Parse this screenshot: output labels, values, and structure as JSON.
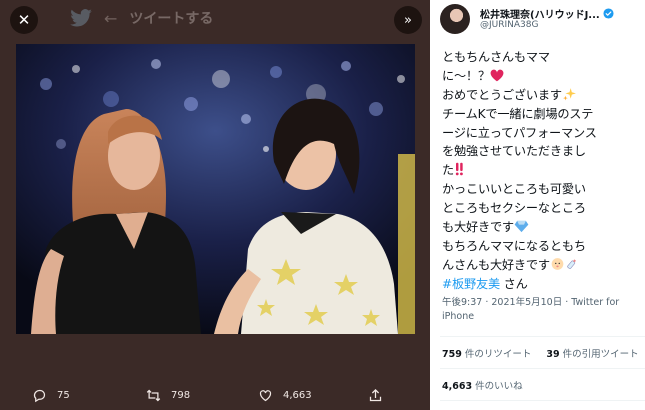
{
  "header": {
    "title": "ツイートする"
  },
  "viewer": {
    "actions": {
      "reply_count": "75",
      "retweet_count": "798",
      "like_count": "4,663"
    }
  },
  "tweet": {
    "display_name": "松井珠理奈(ハリウッドJ...",
    "handle": "@JURINA38G",
    "text_lines": [
      "ともちんさんもママ",
      "に〜！？",
      "おめでとうございます",
      "チームKで一緒に劇場のステ",
      "ージに立ってパフォーマンス",
      "を勉強させていただきまし",
      "た",
      "かっこいいところも可愛い",
      "ところもセクシーなところ",
      "も大好きです",
      "もちろんママになるともち",
      "んさんも大好きです",
      "#板野友美",
      " さん"
    ],
    "timestamp_line1": "午後9:37 · 2021年5月10日 · Twitter for",
    "timestamp_line2": "iPhone",
    "retweets": {
      "count": "759",
      "label": " 件のリツイート"
    },
    "quotes": {
      "count": "39",
      "label": " 件の引用ツイート"
    },
    "likes": {
      "count": "4,663",
      "label": " 件のいいね"
    }
  },
  "colors": {
    "viewer_bg": "#3b2a27",
    "link": "#1d9bf0",
    "verified": "#1d9bf0"
  }
}
